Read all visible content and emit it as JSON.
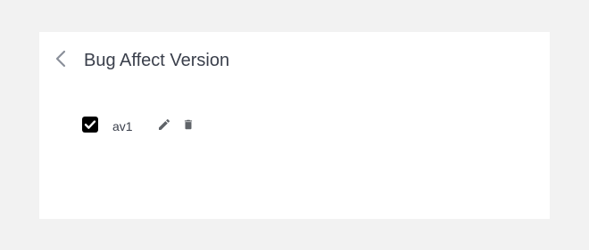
{
  "header": {
    "title": "Bug Affect Version",
    "back_icon": "chevron-left-icon"
  },
  "items": [
    {
      "label": "av1",
      "checked": true,
      "edit_icon": "pencil-icon",
      "delete_icon": "trash-icon"
    }
  ],
  "colors": {
    "background": "#f2f2f2",
    "panel": "#ffffff",
    "text": "#3a3f4b",
    "icon": "#5f6368",
    "back_icon": "#8a8f99",
    "checkbox": "#000000"
  }
}
